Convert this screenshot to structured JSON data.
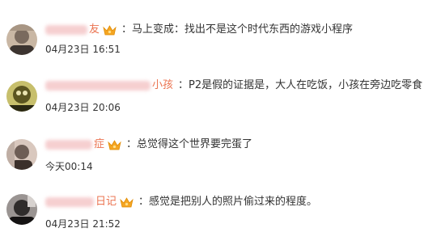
{
  "comments": [
    {
      "name_tail": "友",
      "text": "：马上变成：找出不是这个时代东西的游戏小程序",
      "time": "04月23日 16:51",
      "has_crown": true,
      "avatar_colors": [
        "#7a6a5e",
        "#c9b7a4",
        "#3c3430"
      ]
    },
    {
      "name_tail": "小孩",
      "text": "：P2是假的证据是，大人在吃饭，小孩在旁边吃零食",
      "time": "04月23日 20:06",
      "has_crown": false,
      "avatar_colors": [
        "#5b5520",
        "#c7bf6c",
        "#2a2812"
      ]
    },
    {
      "name_tail": "症",
      "text": "：总觉得这个世界要完蛋了",
      "time": "今天00:14",
      "has_crown": true,
      "avatar_colors": [
        "#6d5d55",
        "#d9c8be",
        "#3b302b"
      ]
    },
    {
      "name_tail": "日记",
      "text": "：感觉是把别人的照片偷过来的程度。",
      "time": "04月23日 21:52",
      "has_crown": true,
      "avatar_colors": [
        "#2f2c2b",
        "#9a9492",
        "#151313"
      ]
    }
  ]
}
